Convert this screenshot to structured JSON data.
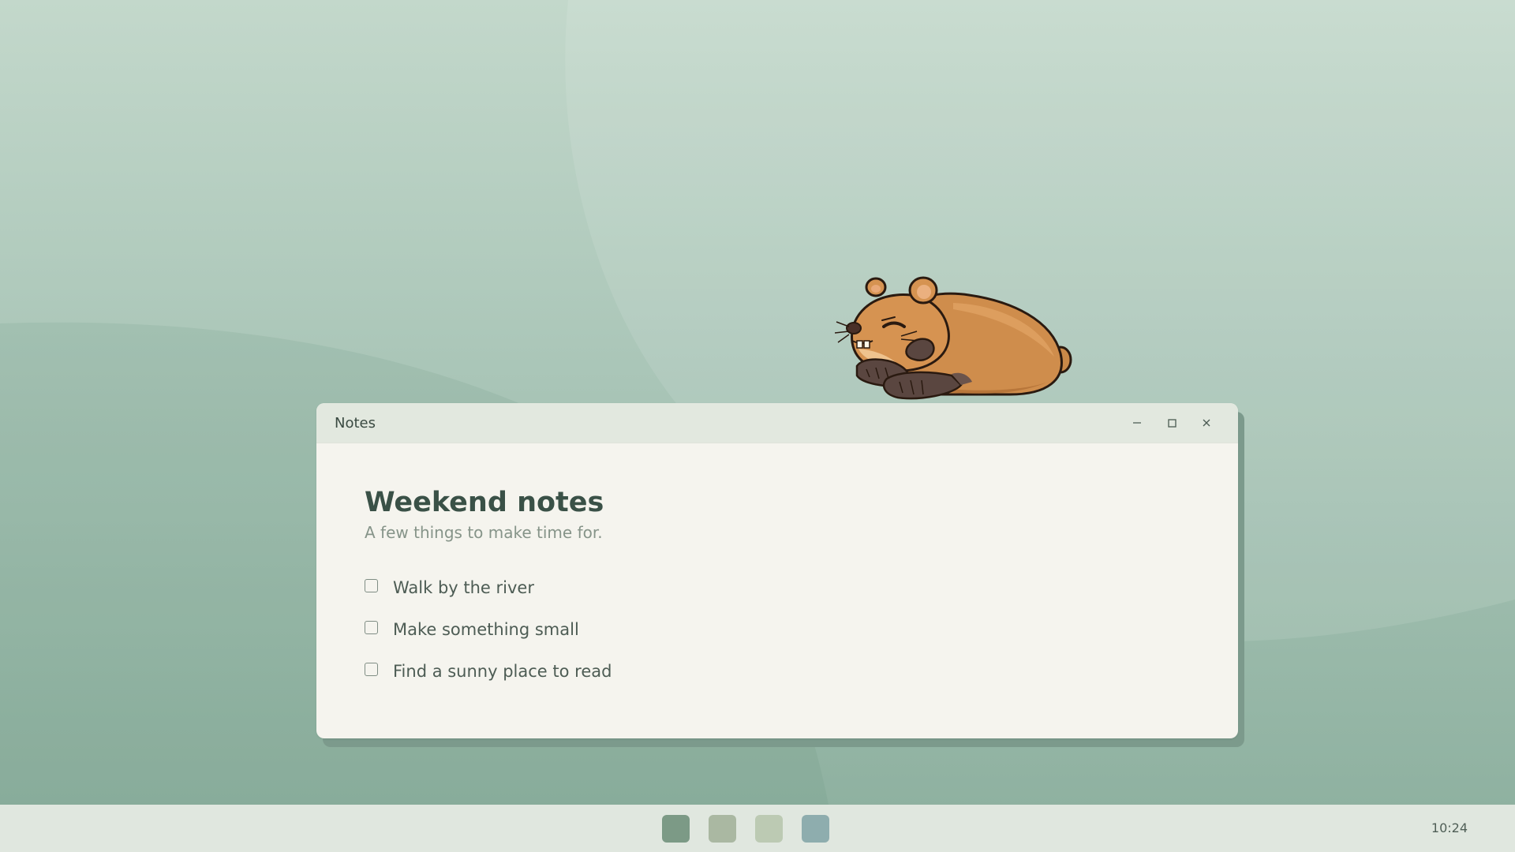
{
  "window": {
    "title": "Notes",
    "controls": [
      {
        "name": "minimize",
        "icon": "minimize-icon"
      },
      {
        "name": "maximize",
        "icon": "maximize-icon"
      },
      {
        "name": "close",
        "icon": "close-icon"
      }
    ]
  },
  "note": {
    "title": "Weekend notes",
    "subtitle": "A few things to make time for.",
    "items": [
      {
        "label": "Walk by the river",
        "checked": false
      },
      {
        "label": "Make something small",
        "checked": false
      },
      {
        "label": "Find a sunny place to read",
        "checked": false
      }
    ]
  },
  "taskbar": {
    "apps": [
      {
        "icon": "app-icon",
        "color": "#7c9a86"
      },
      {
        "icon": "app-icon",
        "color": "#aab8a2"
      },
      {
        "icon": "app-icon",
        "color": "#bccab3"
      },
      {
        "icon": "app-icon",
        "color": "#8eadae"
      }
    ],
    "clock": "10:24"
  },
  "desktop": {
    "pet": "hamster-sprite"
  },
  "colors": {
    "window_bg": "#f5f4ee",
    "titlebar_bg": "#e2e8df",
    "title_text": "#3a5147",
    "taskbar_bg": "#e0e7df"
  }
}
